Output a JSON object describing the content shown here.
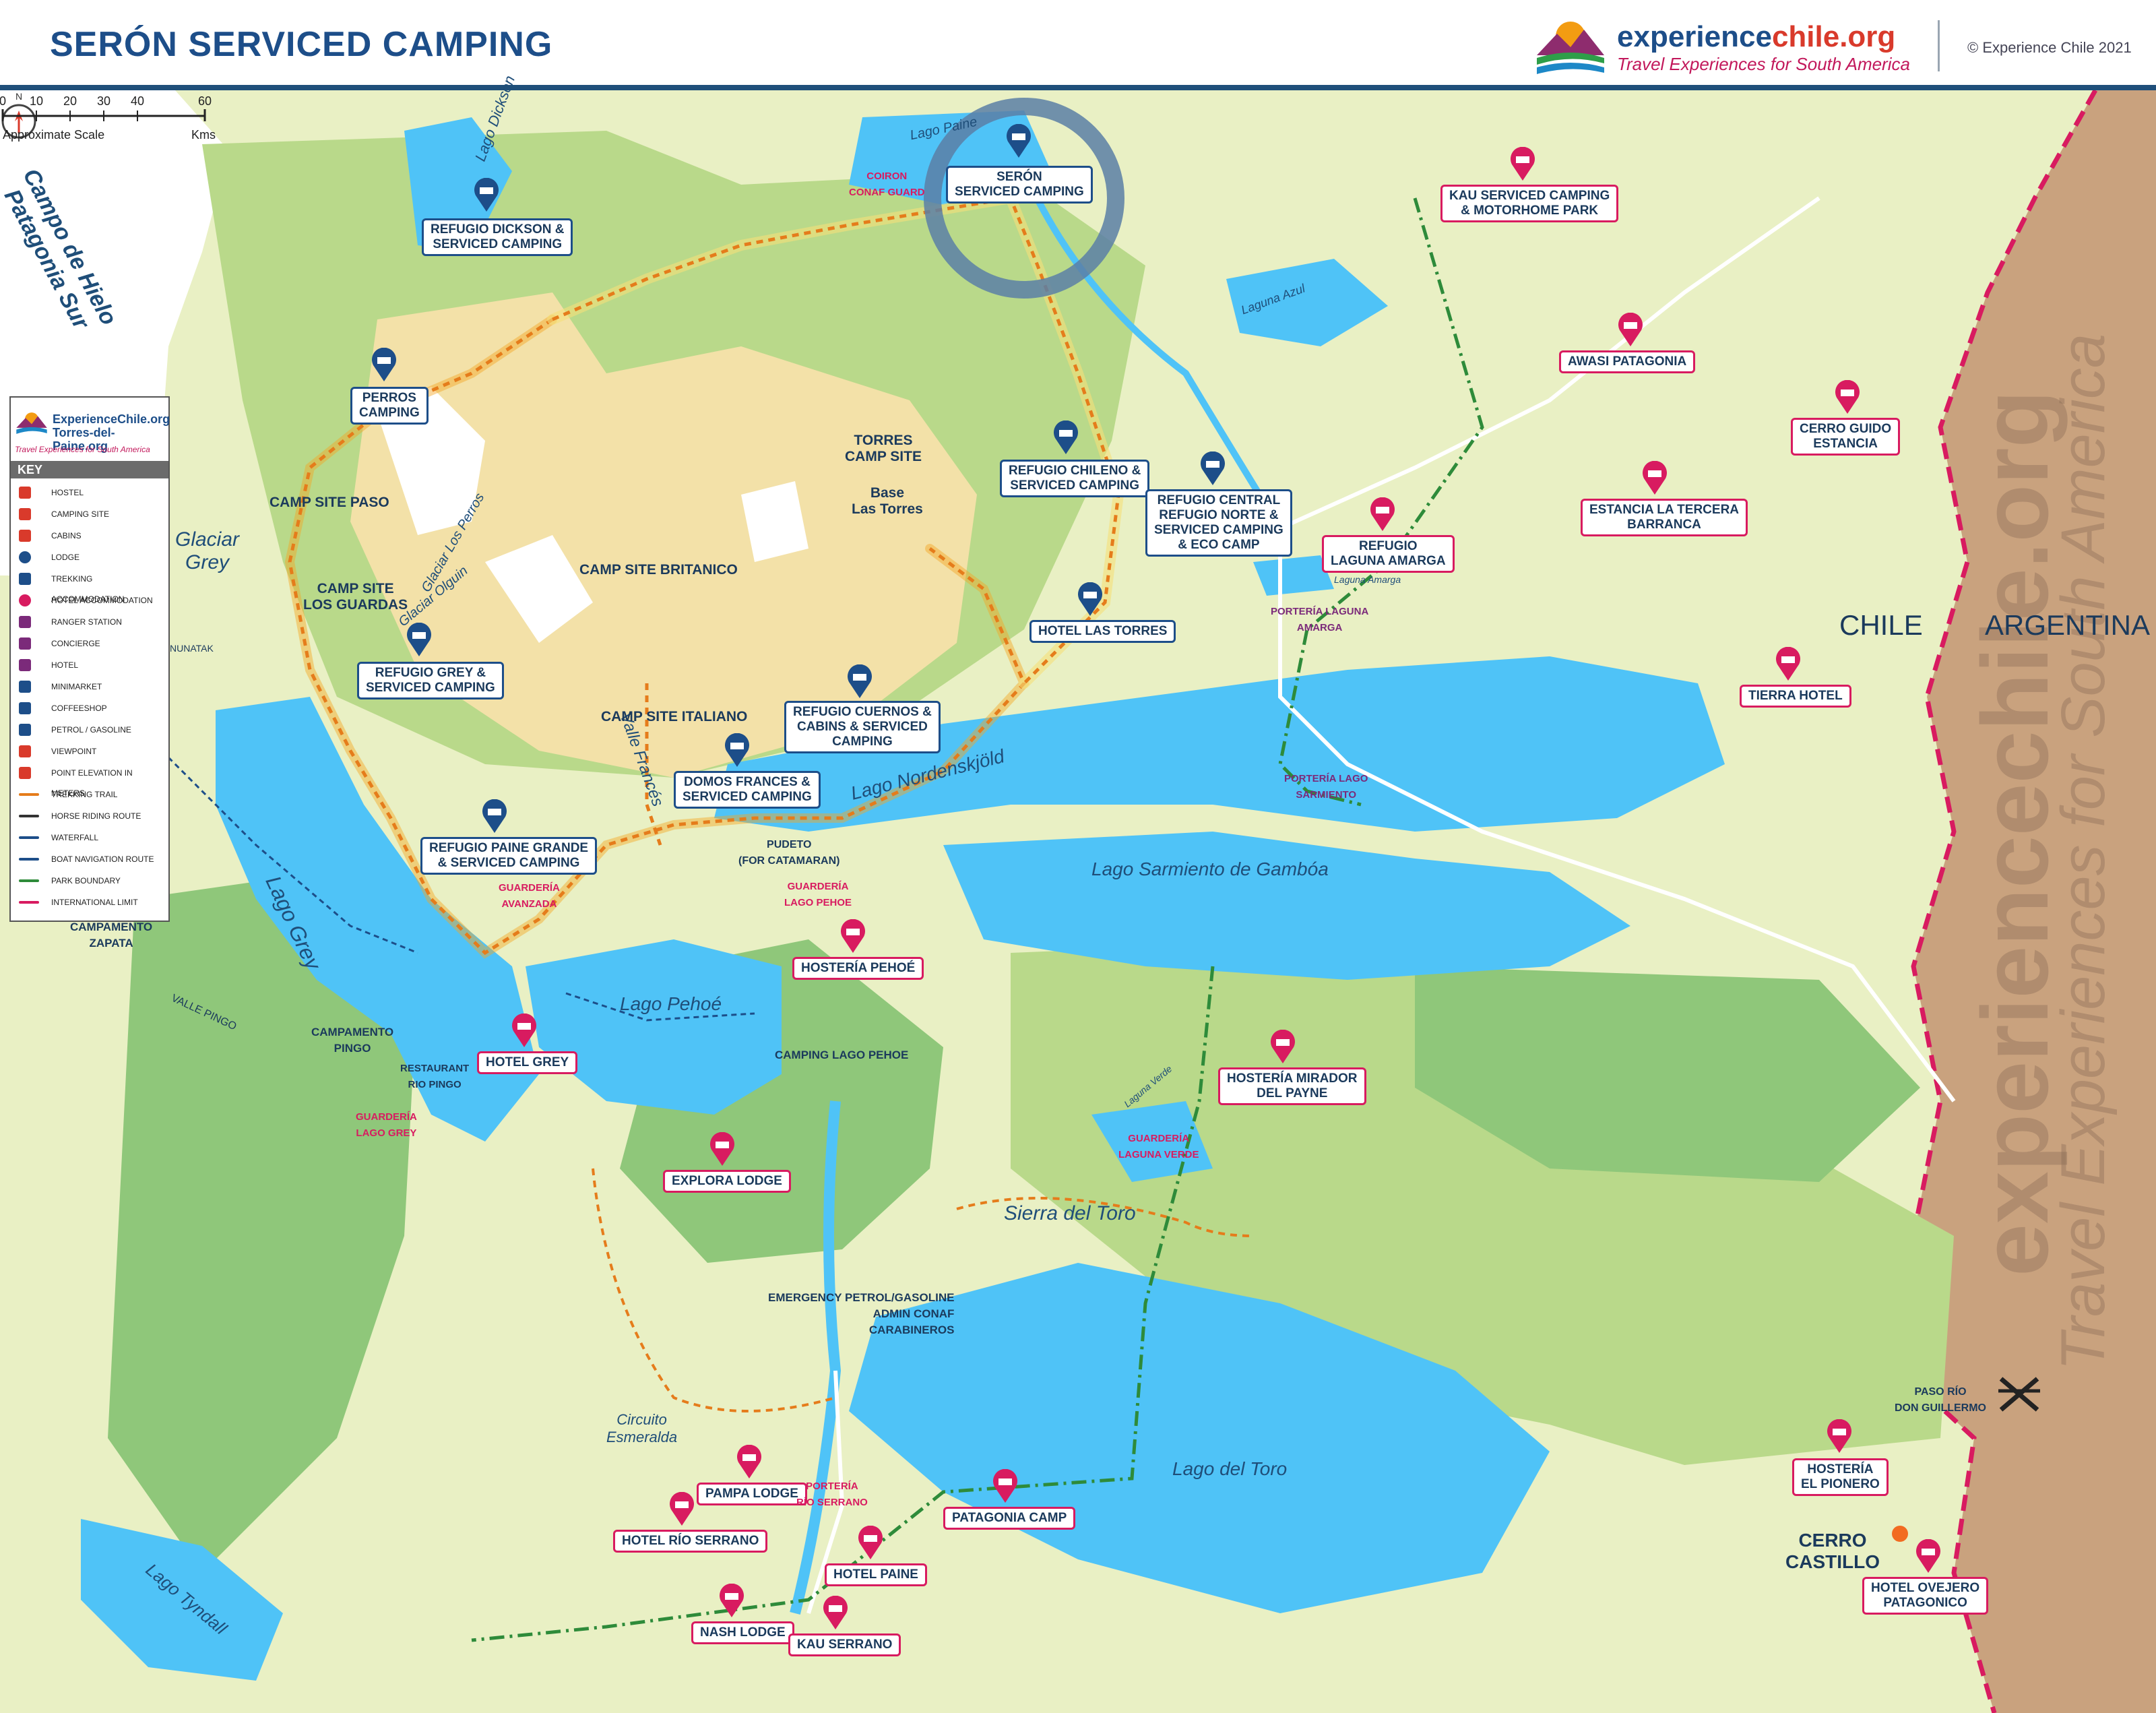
{
  "header": {
    "title": "SERÓN SERVICED CAMPING",
    "brand_name_part1": "experience",
    "brand_name_part2": "chile.org",
    "brand_tagline": "Travel Experiences for South America",
    "copyright": "© Experience Chile 2021"
  },
  "colors": {
    "land_light": "#e9f0c4",
    "land_green": "#b9d98a",
    "forest": "#8fc77a",
    "rock": "#f3e1a8",
    "water": "#4fc3f7",
    "argentina": "#c9a27e",
    "brand_blue": "#1d4e89",
    "brand_pink": "#d81b60",
    "trail_orange": "#e57c1b"
  },
  "key": {
    "logo_title_1": "ExperienceChile.org",
    "logo_title_2": "Torres-del-Paine.org",
    "logo_tagline": "Travel Experiences for South America",
    "heading": "KEY",
    "items": [
      {
        "icon": "hostel-icon",
        "label": "HOSTEL"
      },
      {
        "icon": "camping-site-icon",
        "label": "CAMPING SITE"
      },
      {
        "icon": "cabins-icon",
        "label": "CABINS"
      },
      {
        "icon": "lodge-icon",
        "label": "LODGE"
      },
      {
        "icon": "trekking-accommodation-icon",
        "label": "TREKKING ACCOMMODATION"
      },
      {
        "icon": "hotel-accommodation-icon",
        "label": "HOTEL ACCOMMODATION"
      },
      {
        "icon": "ranger-station-icon",
        "label": "RANGER STATION"
      },
      {
        "icon": "concierge-icon",
        "label": "CONCIERGE"
      },
      {
        "icon": "hotel-icon",
        "label": "HOTEL"
      },
      {
        "icon": "minimarket-icon",
        "label": "MINIMARKET"
      },
      {
        "icon": "coffeeshop-icon",
        "label": "COFFEESHOP"
      },
      {
        "icon": "petrol-icon",
        "label": "PETROL / GASOLINE"
      },
      {
        "icon": "viewpoint-icon",
        "label": "VIEWPOINT"
      },
      {
        "icon": "point-elevation-icon",
        "label": "POINT ELEVATION IN METERS"
      },
      {
        "icon": "trekking-trail-icon",
        "label": "TREKKING TRAIL"
      },
      {
        "icon": "horse-riding-icon",
        "label": "HORSE RIDING ROUTE"
      },
      {
        "icon": "waterfall-icon",
        "label": "WATERFALL"
      },
      {
        "icon": "boat-route-icon",
        "label": "BOAT NAVIGATION ROUTE"
      },
      {
        "icon": "park-boundary-icon",
        "label": "PARK BOUNDARY"
      },
      {
        "icon": "international-limit-icon",
        "label": "INTERNATIONAL LIMIT"
      }
    ]
  },
  "regions": {
    "ice_field": "Campo de Hielo\nPatagonia Sur",
    "chile": "CHILE",
    "argentina": "ARGENTINA",
    "sierra": "Sierra del Toro",
    "circuito": "Circuito\nEsmeralda",
    "valle_frances": "Valle Francés",
    "valle_pingo": "VALLE PINGO",
    "nunatak": "NUNATAK"
  },
  "water_bodies": {
    "lago_dickson": "Lago Dickson",
    "lago_paine": "Lago Paine",
    "glaciar_grey": "Glaciar\nGrey",
    "glaciar_olguin": "Glaciar Olguin",
    "glaciar_perros": "Glaciar Los Perros",
    "lago_grey": "Lago Grey",
    "lago_nordenskjold": "Lago Nordenskjöld",
    "lago_sarmiento": "Lago Sarmiento de Gambóa",
    "lago_pehoe": "Lago Pehoé",
    "lago_toro": "Lago del Toro",
    "lago_tyndall": "Lago Tyndall",
    "laguna_azul": "Laguna Azul",
    "laguna_amarga": "Laguna Amarga",
    "laguna_verde": "Laguna Verde"
  },
  "places": {
    "seron": "SERÓN\nSERVICED CAMPING",
    "coiron": "COIRON\nCONAF GUARD",
    "dickson": "REFUGIO DICKSON &\nSERVICED CAMPING",
    "perros": "PERROS\nCAMPING",
    "camp_paso": "CAMP SITE PASO",
    "camp_guardas": "CAMP SITE\nLOS GUARDAS",
    "grey_camping": "REFUGIO GREY &\nSERVICED CAMPING",
    "camp_britanico": "CAMP SITE BRITANICO",
    "camp_italiano": "CAMP SITE ITALIANO",
    "torres_camp": "TORRES\nCAMP SITE",
    "base_torres": "Base\nLas Torres",
    "chileno": "REFUGIO CHILENO &\nSERVICED CAMPING",
    "central": "REFUGIO CENTRAL\nREFUGIO NORTE &\nSERVICED CAMPING\n& ECO CAMP",
    "hotel_torres": "HOTEL LAS TORRES",
    "cuernos": "REFUGIO CUERNOS &\nCABINS & SERVICED\nCAMPING",
    "domos": "DOMOS FRANCES &\nSERVICED CAMPING",
    "paine_grande": "REFUGIO PAINE GRANDE\n& SERVICED CAMPING",
    "guarderia_avanzada": "GUARDERÍA\nAVANZADA",
    "pudeto": "PUDETO\n(FOR CATAMARAN)",
    "guarderia_pehoe": "GUARDERÍA\nLAGO PEHOE",
    "hosteria_pehoe": "HOSTERÍA PEHOÉ",
    "camping_pehoe": "CAMPING LAGO PEHOE",
    "explora": "EXPLORA LODGE",
    "hotel_grey": "HOTEL GREY",
    "restaurant_pingo": "RESTAURANT\nRIO PINGO",
    "guarderia_grey": "GUARDERÍA\nLAGO GREY",
    "campamento_pingo": "CAMPAMENTO\nPINGO",
    "campamento_zapata": "CAMPAMENTO\nZAPATA",
    "kau_serviced": "KAU SERVICED CAMPING\n& MOTORHOME PARK",
    "awasi": "AWASI PATAGONIA",
    "cerro_guido": "CERRO GUIDO\nESTANCIA",
    "tercera_barranca": "ESTANCIA LA TERCERA\nBARRANCA",
    "refugio_amarga": "REFUGIO\nLAGUNA AMARGA",
    "porteria_amarga": "PORTERÍA LAGUNA\nAMARGA",
    "porteria_sarmiento": "PORTERÍA LAGO\nSARMIENTO",
    "tierra": "TIERRA HOTEL",
    "mirador_payne": "HOSTERÍA MIRADOR\nDEL PAYNE",
    "guarderia_verde": "GUARDERÍA\nLAGUNA VERDE",
    "emergency": "EMERGENCY PETROL/GASOLINE\nADMIN CONAF\nCARABINEROS",
    "pampa": "PAMPA LODGE",
    "porteria_serrano": "PORTERÍA\nRÍO SERRANO",
    "hotel_serrano": "HOTEL RÍO SERRANO",
    "hotel_paine": "HOTEL PAINE",
    "nash": "NASH LODGE",
    "kau_serrano": "KAU SERRANO",
    "patagonia_camp": "PATAGONIA CAMP",
    "pionero": "HOSTERÍA\nEL PIONERO",
    "cerro_castillo": "CERRO\nCASTILLO",
    "ovejero": "HOTEL OVEJERO\nPATAGONICO",
    "don_guillermo": "PASO RÍO\nDON GUILLERMO"
  },
  "scale": {
    "ticks": [
      "0",
      "10",
      "20",
      "30",
      "40",
      "60"
    ],
    "caption": "Approximate Scale",
    "unit": "Kms"
  },
  "watermark": {
    "line1": "experiencechile.org",
    "line2": "Travel Experiences for South America"
  }
}
